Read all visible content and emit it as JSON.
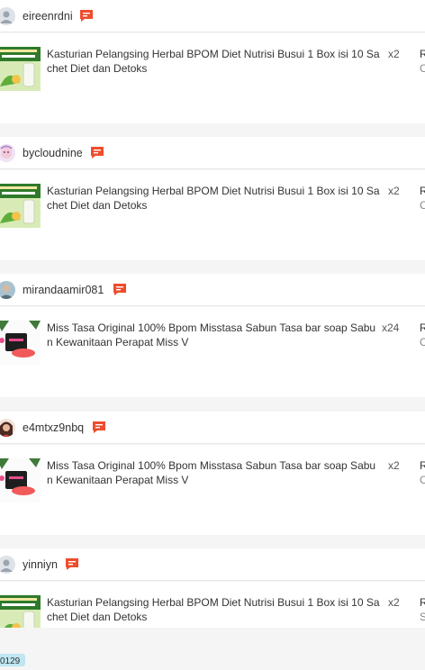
{
  "colors": {
    "accent": "#ee4d2d",
    "badge": "#bfe6f2"
  },
  "orders": [
    {
      "username": "eireenrdni",
      "avatar": "default-user-icon",
      "product": "Kasturian Pelangsing Herbal BPOM Diet Nutrisi Busui 1 Box isi 10 Sachet Diet dan Detoks",
      "qty": "x2",
      "col1": "R",
      "col2": "C"
    },
    {
      "username": "bycloudnine",
      "avatar": "cartoon-avatar",
      "product": "Kasturian Pelangsing Herbal BPOM Diet Nutrisi Busui 1 Box isi 10 Sachet Diet dan Detoks",
      "qty": "x2",
      "col1": "R",
      "col2": "C"
    },
    {
      "username": "mirandaamir081",
      "avatar": "photo-avatar",
      "product": "Miss Tasa Original 100% Bpom Misstasa Sabun Tasa bar soap Sabun Kewanitaan Perapat Miss V",
      "qty": "x24",
      "col1": "R",
      "col2": "C"
    },
    {
      "username": "e4mtxz9nbq",
      "avatar": "photo-avatar",
      "product": "Miss Tasa Original 100% Bpom Misstasa Sabun Tasa bar soap Sabun Kewanitaan Perapat Miss V",
      "qty": "x2",
      "col1": "R",
      "col2": "C"
    },
    {
      "username": "yinniyn",
      "avatar": "default-user-icon",
      "product": "Kasturian Pelangsing Herbal BPOM Diet Nutrisi Busui 1 Box isi 10 Sachet Diet dan Detoks",
      "qty": "x2",
      "col1": "R",
      "col2": "S"
    }
  ],
  "bottom_badge": "0129"
}
